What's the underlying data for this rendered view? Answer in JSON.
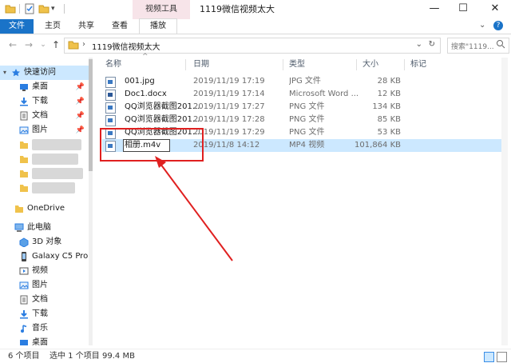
{
  "titlebar": {
    "context_tab": "视频工具",
    "title": "1119微信视频太大",
    "controls": {
      "minimize": "—",
      "maximize": "☐",
      "close": "✕"
    }
  },
  "ribbon": {
    "file": "文件",
    "tabs": [
      "主页",
      "共享",
      "查看",
      "播放"
    ],
    "active_tab": "播放",
    "expand": "⌄",
    "help": "?"
  },
  "address": {
    "path_sep": "›",
    "folder": "1119微信视频太大",
    "dropdown": "⌄",
    "refresh": "↻",
    "search_placeholder": "搜索\"1119..."
  },
  "nav": {
    "back": "←",
    "forward": "→",
    "recent": "⌄",
    "up": "↑"
  },
  "sidebar": {
    "quick_access": "快速访问",
    "quick_items": [
      {
        "label": "桌面",
        "icon": "desktop-icon"
      },
      {
        "label": "下载",
        "icon": "download-icon"
      },
      {
        "label": "文档",
        "icon": "document-icon"
      },
      {
        "label": "图片",
        "icon": "picture-icon"
      }
    ],
    "onedrive": "OneDrive",
    "this_pc": "此电脑",
    "pc_items": [
      {
        "label": "3D 对象",
        "icon": "3d-objects-icon"
      },
      {
        "label": "Galaxy C5 Pro",
        "icon": "phone-icon"
      },
      {
        "label": "视频",
        "icon": "video-icon"
      },
      {
        "label": "图片",
        "icon": "picture-icon"
      },
      {
        "label": "文档",
        "icon": "document-icon"
      },
      {
        "label": "下载",
        "icon": "download-icon"
      },
      {
        "label": "音乐",
        "icon": "music-icon"
      },
      {
        "label": "桌面",
        "icon": "desktop-icon"
      }
    ]
  },
  "columns": {
    "name": "名称",
    "date": "日期",
    "type": "类型",
    "size": "大小",
    "tags": "标记"
  },
  "files": [
    {
      "name": "001.jpg",
      "date": "2019/11/19 17:19",
      "type": "JPG 文件",
      "size": "28 KB"
    },
    {
      "name": "Doc1.docx",
      "date": "2019/11/19 17:14",
      "type": "Microsoft Word ...",
      "size": "12 KB"
    },
    {
      "name": "QQ浏览器截图201...",
      "date": "2019/11/19 17:27",
      "type": "PNG 文件",
      "size": "134 KB"
    },
    {
      "name": "QQ浏览器截图201...",
      "date": "2019/11/19 17:28",
      "type": "PNG 文件",
      "size": "85 KB"
    },
    {
      "name": "QQ浏览器截图201...",
      "date": "2019/11/19 17:29",
      "type": "PNG 文件",
      "size": "53 KB"
    },
    {
      "name": "相册.m4v",
      "date": "2019/11/8 14:12",
      "type": "MP4 视频",
      "size": "101,864 KB"
    }
  ],
  "status": {
    "count": "6 个项目",
    "selected": "选中 1 个项目",
    "size": "99.4 MB"
  },
  "colors": {
    "accent": "#1a73c8",
    "selection": "#cce8ff",
    "annotation": "#e02020",
    "context_tab": "#f7e4e9"
  }
}
